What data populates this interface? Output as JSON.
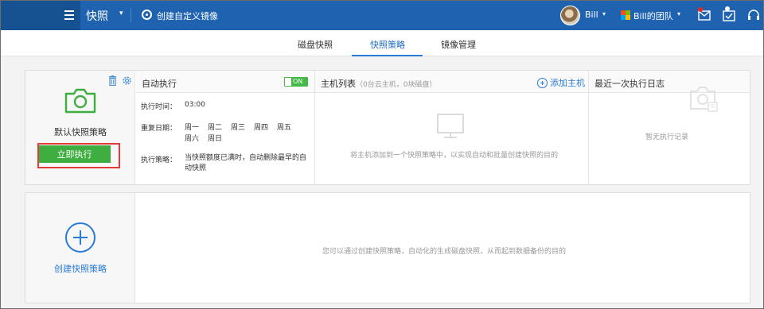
{
  "header": {
    "product": "快照",
    "create_image": "创建自定义镜像",
    "user_name": "Bill",
    "team_name": "Bill的团队",
    "icons": [
      "menu-icon",
      "create-image-icon",
      "avatar",
      "team-logo",
      "message-icon",
      "task-icon",
      "support-headset-icon"
    ]
  },
  "tabs": [
    {
      "label": "磁盘快照",
      "active": false
    },
    {
      "label": "快照策略",
      "active": true
    },
    {
      "label": "镜像管理",
      "active": false
    }
  ],
  "policy": {
    "name": "默认快照策略",
    "run_now": "立即执行",
    "auto_exec": {
      "title": "自动执行",
      "toggle_state": "ON",
      "time_label": "执行时间：",
      "time_value": "03:00",
      "days_label": "重复日期：",
      "days": [
        "周一",
        "周二",
        "周三",
        "周四",
        "周五",
        "周六",
        "周日"
      ],
      "strategy_label": "执行策略：",
      "strategy_value": "当快照额度已满时，自动删除最早的自动快照"
    },
    "hosts": {
      "title": "主机列表",
      "subtitle": "（0台云主机，0块磁盘）",
      "add_label": "添加主机",
      "empty_hint": "将主机添加到一个快照策略中，以实现自动和批量创建快照的目的"
    },
    "log": {
      "title": "最近一次执行日志",
      "empty": "暂无执行记录"
    }
  },
  "create_card": {
    "label": "创建快照策略",
    "hint": "您可以通过创建快照策略，自动化的生成磁盘快照，从而起到数据备份的目的"
  },
  "colors": {
    "topbar": "#1f63b0",
    "accent": "#2a7bd6",
    "run_button": "#3dae3f",
    "highlight": "#e33a3a",
    "toggle_on": "#45b945"
  }
}
